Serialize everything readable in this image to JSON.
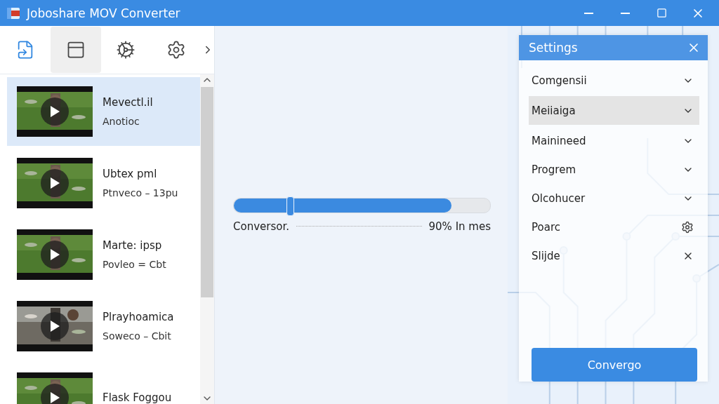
{
  "window": {
    "title": "Joboshare MOV Converter"
  },
  "toolbar": {
    "tools": [
      {
        "selected": false
      },
      {
        "selected": true
      },
      {
        "selected": false
      },
      {
        "selected": false
      }
    ]
  },
  "videos": [
    {
      "title": "Mevectl.il",
      "subtitle": "Anotioc",
      "selected": true
    },
    {
      "title": "Ubtex pml",
      "subtitle": "Ptnveco  –  13pu",
      "selected": false
    },
    {
      "title": "Marte: ipsp",
      "subtitle": "Povleo  =  Cbt",
      "selected": false
    },
    {
      "title": "Plrayhoamica",
      "subtitle": "Soweco  –  Cbit",
      "selected": false
    },
    {
      "title": "Flask Foggou",
      "selected": false
    }
  ],
  "progress": {
    "level": 0.85,
    "handle": {
      "level": 0.22
    },
    "label": "Conversor.",
    "reading": "90% In mes"
  },
  "settings": {
    "title": "Settings",
    "items": [
      {
        "label": "Comgensii",
        "kind": "dropdown",
        "selected": false
      },
      {
        "label": "Meiiaiga",
        "kind": "dropdown",
        "selected": true
      },
      {
        "label": "Mainineed",
        "kind": "dropdown",
        "selected": false
      },
      {
        "label": "Progrem",
        "kind": "dropdown",
        "selected": false
      },
      {
        "label": "Olcohucer",
        "kind": "dropdown",
        "selected": false
      },
      {
        "label": "Poarc",
        "kind": "gear",
        "selected": false
      },
      {
        "label": "Slijde",
        "kind": "close",
        "selected": false
      }
    ]
  },
  "convert_button": "Convergo"
}
